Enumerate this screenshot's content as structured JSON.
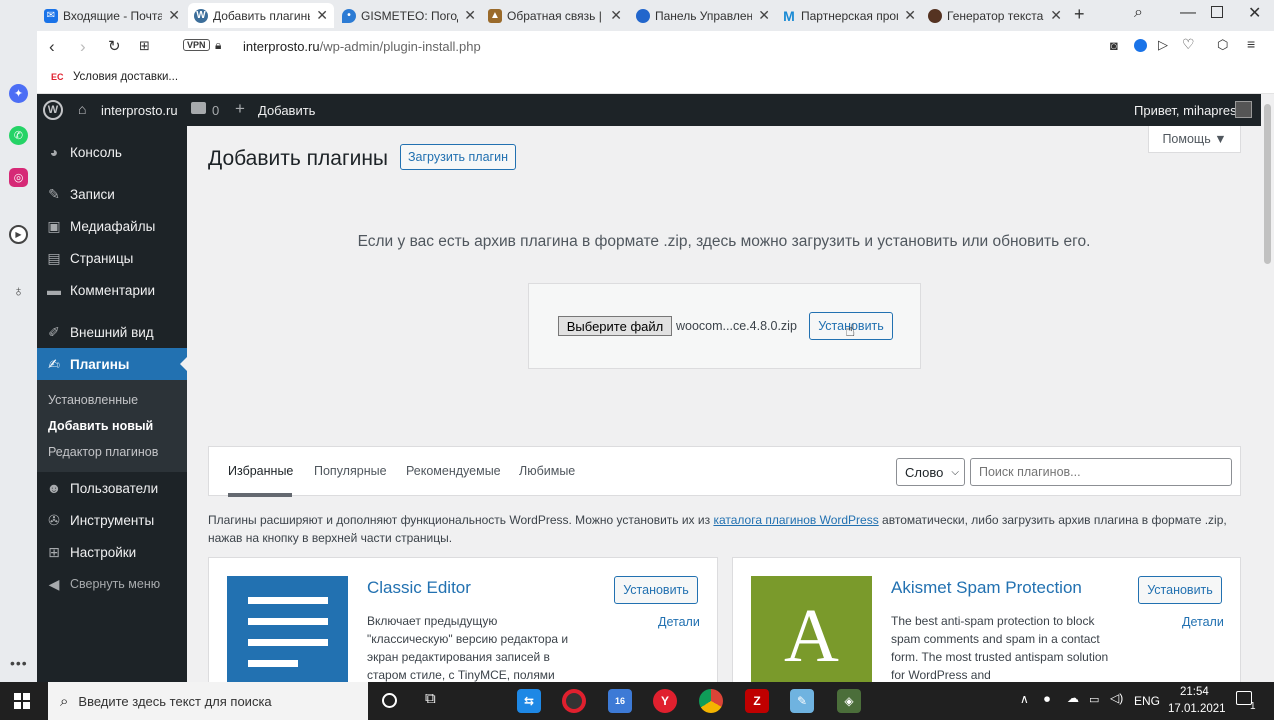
{
  "browser": {
    "tabs": [
      {
        "title": "Входящие - Почта",
        "icon": "mail-icon",
        "color": "#1a73e8"
      },
      {
        "title": "Добавить плагины",
        "icon": "wordpress-icon",
        "color": "#3c6e9a",
        "active": true
      },
      {
        "title": "GISMETEO: Погода",
        "icon": "gismeteo-icon",
        "color": "#2c7bd4"
      },
      {
        "title": "Обратная связь |",
        "icon": "feedback-icon",
        "color": "#9a6a2a"
      },
      {
        "title": "Панель Управлени",
        "icon": "panel-icon",
        "color": "#2266cc"
      },
      {
        "title": "Партнерская прог",
        "icon": "m-logo-icon",
        "color": "#1a8ad4"
      },
      {
        "title": "Генератор текста",
        "icon": "avatar-icon",
        "color": "#553322"
      }
    ],
    "url_domain": "interprosto.ru",
    "url_path": "/wp-admin/plugin-install.php",
    "vpn_label": "VPN",
    "bookmark": "Условия доставки..."
  },
  "admin_bar": {
    "site_name": "interprosto.ru",
    "comments_count": "0",
    "add_label": "Добавить",
    "greeting": "Привет, mihapres"
  },
  "menu": {
    "items": [
      {
        "label": "Консоль",
        "icon": "dashboard-icon"
      },
      {
        "label": "Записи",
        "icon": "pin-icon"
      },
      {
        "label": "Медиафайлы",
        "icon": "media-icon"
      },
      {
        "label": "Страницы",
        "icon": "pages-icon"
      },
      {
        "label": "Комментарии",
        "icon": "comment-icon"
      },
      {
        "label": "Внешний вид",
        "icon": "brush-icon"
      },
      {
        "label": "Плагины",
        "icon": "plugin-icon",
        "current": true
      },
      {
        "label": "Пользователи",
        "icon": "users-icon"
      },
      {
        "label": "Инструменты",
        "icon": "tools-icon"
      },
      {
        "label": "Настройки",
        "icon": "settings-icon"
      },
      {
        "label": "Свернуть меню",
        "icon": "collapse-icon"
      }
    ],
    "submenu": [
      "Установленные",
      "Добавить новый",
      "Редактор плагинов"
    ]
  },
  "page": {
    "title": "Добавить плагины",
    "upload_button": "Загрузить плагин",
    "help": "Помощь ▼",
    "upload_text": "Если у вас есть архив плагина в формате .zip, здесь можно загрузить и установить или обновить его.",
    "choose_file": "Выберите файл",
    "file_name": "woocom...ce.4.8.0.zip",
    "install_now": "Установить",
    "filter_tabs": [
      "Избранные",
      "Популярные",
      "Рекомендуемые",
      "Любимые"
    ],
    "search_type": "Слово",
    "search_placeholder": "Поиск плагинов...",
    "desc_before": "Плагины расширяют и дополняют функциональность WordPress. Можно установить их из ",
    "desc_link": "каталога плагинов WordPress",
    "desc_after": " автоматически, либо загрузить архив плагина в формате .zip, нажав на кнопку в верхней части страницы."
  },
  "plugins": [
    {
      "name": "Classic Editor",
      "install": "Установить",
      "details": "Детали",
      "description": "Включает предыдущую \"классическую\" версию редактора и экран редактирования записей в старом стиле, с TinyMCE, полями",
      "icon_color": "#2271b1"
    },
    {
      "name": "Akismet Spam Protection",
      "install": "Установить",
      "details": "Детали",
      "description": "The best anti-spam protection to block spam comments and spam in a contact form. The most trusted antispam solution for WordPress and",
      "icon_color": "#7a9a2b",
      "icon_letter": "A"
    }
  ],
  "taskbar": {
    "search_placeholder": "Введите здесь текст для поиска",
    "lang": "ENG",
    "time": "21:54",
    "date": "17.01.2021",
    "notif_count": "1"
  }
}
